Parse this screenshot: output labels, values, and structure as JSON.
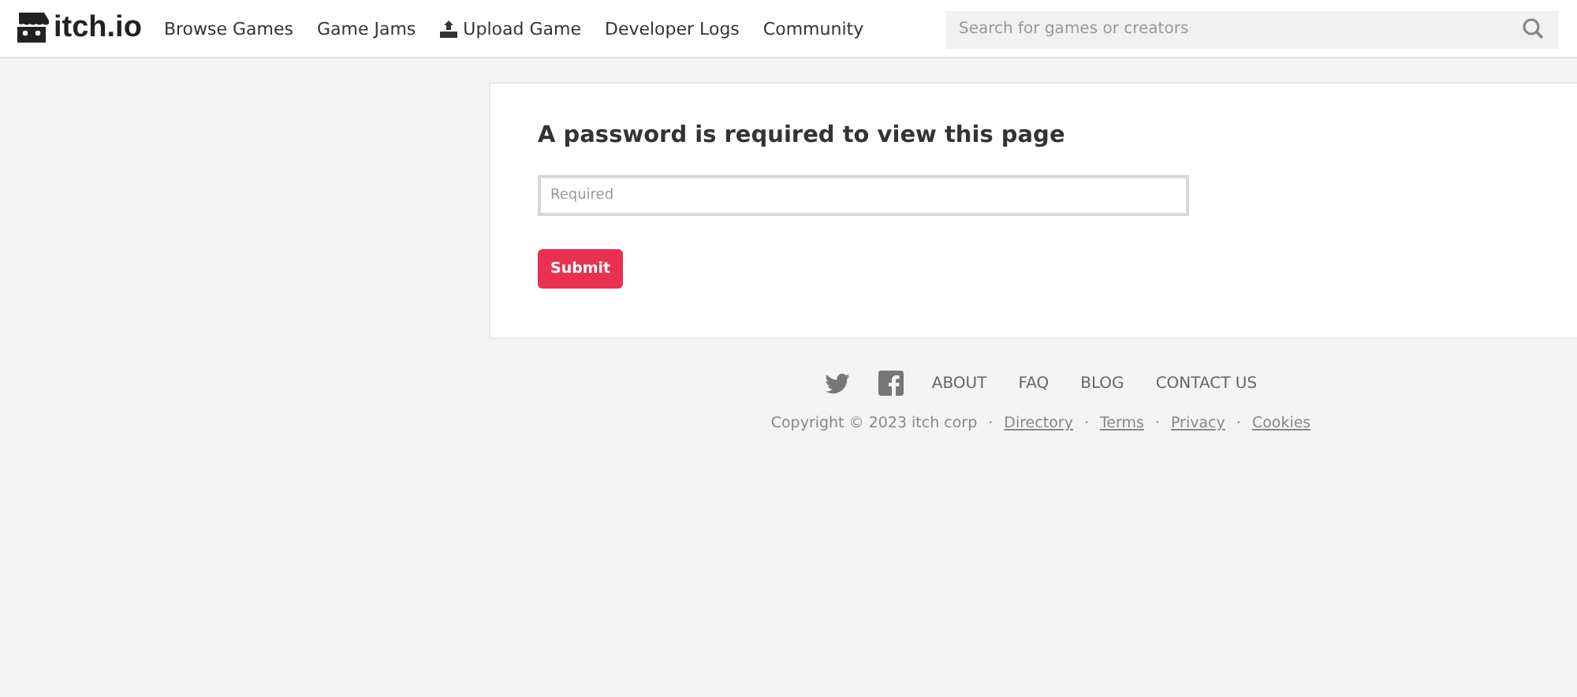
{
  "header": {
    "logo": "itch.io",
    "nav": [
      {
        "label": "Browse Games",
        "kind": "link"
      },
      {
        "label": "Game Jams",
        "kind": "link"
      },
      {
        "label": "Upload Game",
        "kind": "upload"
      },
      {
        "label": "Developer Logs",
        "kind": "link"
      },
      {
        "label": "Community",
        "kind": "link"
      }
    ],
    "search": {
      "placeholder": "Search for games or creators"
    }
  },
  "card": {
    "title": "A password is required to view this page",
    "password": {
      "placeholder": "Required"
    },
    "submit": "Submit"
  },
  "footer": {
    "social": [
      {
        "kind": "twitter"
      },
      {
        "kind": "facebook"
      }
    ],
    "links": [
      "ABOUT",
      "FAQ",
      "BLOG",
      "CONTACT US"
    ],
    "copyright": "Copyright © 2023 itch corp",
    "separator": "·",
    "legal": [
      "Directory",
      "Terms",
      "Privacy",
      "Cookies"
    ]
  }
}
